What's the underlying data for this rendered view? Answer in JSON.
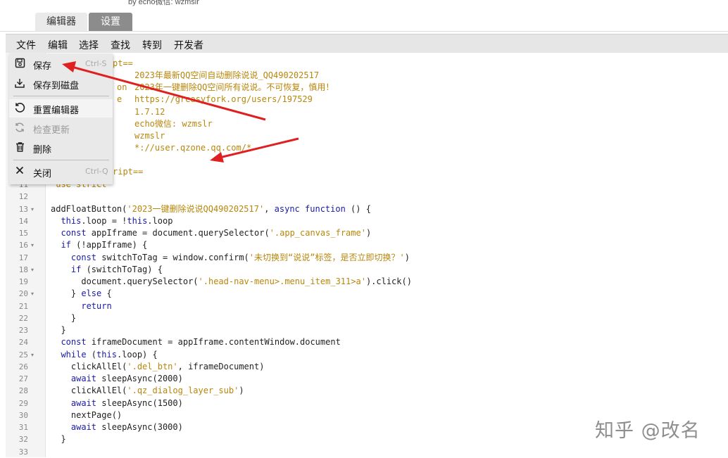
{
  "header": {
    "byline": "by echo微信: wzmslr"
  },
  "tabs": [
    {
      "label": "编辑器"
    },
    {
      "label": "设置"
    }
  ],
  "menubar": [
    "文件",
    "编辑",
    "选择",
    "查找",
    "转到",
    "开发者"
  ],
  "file_menu": [
    {
      "label": "保存",
      "shortcut": "Ctrl-S",
      "icon": "save-icon"
    },
    {
      "label": "保存到磁盘",
      "shortcut": "",
      "icon": "download-icon"
    },
    {
      "label": "重置编辑器",
      "shortcut": "",
      "icon": "reset-icon"
    },
    {
      "label": "检查更新",
      "shortcut": "",
      "icon": "refresh-icon",
      "disabled": true
    },
    {
      "label": "删除",
      "shortcut": "",
      "icon": "trash-icon"
    },
    {
      "label": "关闭",
      "shortcut": "Ctrl-Q",
      "icon": "close-icon"
    }
  ],
  "code_fragments": {
    "l1_tail": "pt==",
    "l2": "2023年最新QQ空间自动删除说说_QQ490202517",
    "l3_key": "on",
    "l3": "2023年一键删除QQ空间所有说说。不可恢复，慎用！",
    "l4_key": "e",
    "l4": "https://greasyfork.org/users/197529",
    "l5": "1.7.12",
    "l6": "echo微信: wzmslr",
    "l7": "wzmslr",
    "l8": "*://user.qzone.qq.com/*",
    "l10_tail": "ript==",
    "l11": "'use strict'"
  },
  "code_lines": [
    {
      "n": "11",
      "fold": false,
      "text": ""
    },
    {
      "n": "12",
      "fold": false,
      "text": ""
    },
    {
      "n": "13",
      "fold": true,
      "text": "addFloatButton('2023一键删除说说QQ490202517', async function () {"
    },
    {
      "n": "14",
      "fold": false,
      "text": "  this.loop = !this.loop"
    },
    {
      "n": "15",
      "fold": false,
      "text": "  const appIframe = document.querySelector('.app_canvas_frame')"
    },
    {
      "n": "16",
      "fold": true,
      "text": "  if (!appIframe) {"
    },
    {
      "n": "17",
      "fold": false,
      "text": "    const switchToTag = window.confirm('未切换到“说说”标签，是否立即切换？')"
    },
    {
      "n": "18",
      "fold": true,
      "text": "    if (switchToTag) {"
    },
    {
      "n": "19",
      "fold": false,
      "text": "      document.querySelector('.head-nav-menu>.menu_item_311>a').click()"
    },
    {
      "n": "20",
      "fold": true,
      "text": "    } else {"
    },
    {
      "n": "21",
      "fold": false,
      "text": "      return"
    },
    {
      "n": "22",
      "fold": false,
      "text": "    }"
    },
    {
      "n": "23",
      "fold": false,
      "text": "  }"
    },
    {
      "n": "24",
      "fold": false,
      "text": "  const iframeDocument = appIframe.contentWindow.document"
    },
    {
      "n": "25",
      "fold": true,
      "text": "  while (this.loop) {"
    },
    {
      "n": "26",
      "fold": false,
      "text": "    clickAllEl('.del_btn', iframeDocument)"
    },
    {
      "n": "27",
      "fold": false,
      "text": "    await sleepAsync(2000)"
    },
    {
      "n": "28",
      "fold": false,
      "text": "    clickAllEl('.qz_dialog_layer_sub')"
    },
    {
      "n": "29",
      "fold": false,
      "text": "    await sleepAsync(1500)"
    },
    {
      "n": "30",
      "fold": false,
      "text": "    nextPage()"
    },
    {
      "n": "31",
      "fold": false,
      "text": "    await sleepAsync(3000)"
    },
    {
      "n": "32",
      "fold": false,
      "text": "  }"
    },
    {
      "n": "33",
      "fold": false,
      "text": ""
    }
  ],
  "watermark": "知乎 @改名",
  "colors": {
    "arrow": "#e02020",
    "menubar_bg": "#e6e6e6",
    "active_tab": "#8c8c8c"
  }
}
